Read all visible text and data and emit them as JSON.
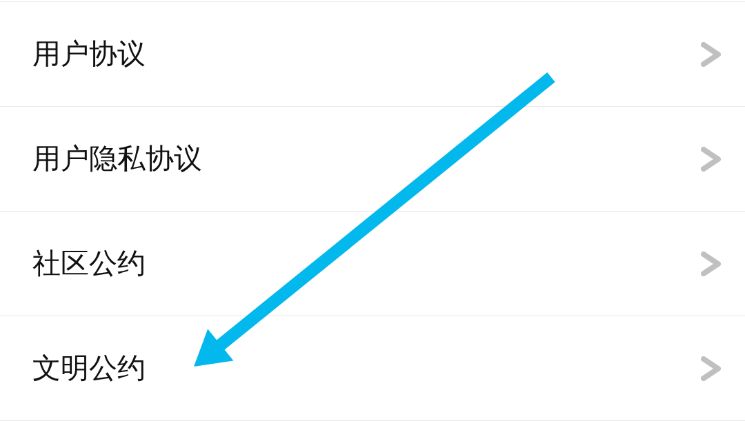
{
  "items": [
    {
      "label": "用户协议"
    },
    {
      "label": "用户隐私协议"
    },
    {
      "label": "社区公约"
    },
    {
      "label": "文明公约"
    }
  ]
}
